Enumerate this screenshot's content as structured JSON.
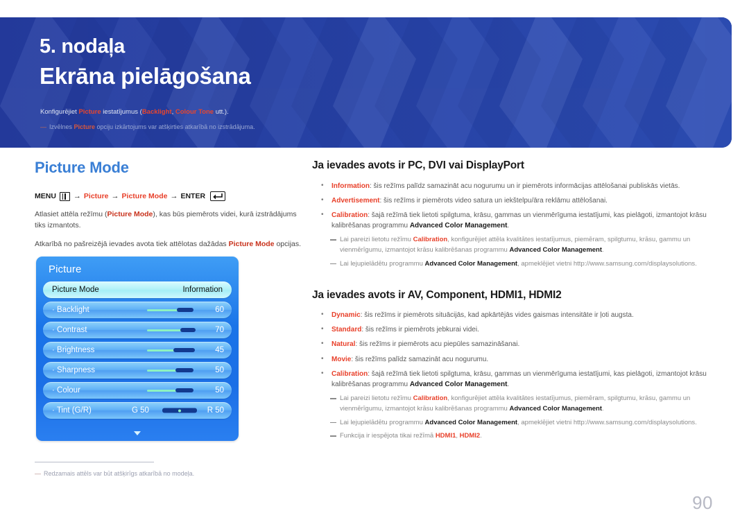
{
  "banner": {
    "chapter_no": "5. nodaļa",
    "chapter_title": "Ekrāna pielāgošana",
    "desc_prefix": "Konfigurējiet ",
    "desc_kw1": "Picture",
    "desc_mid": " iestatījumus (",
    "desc_kw2": "Backlight",
    "desc_sep": ", ",
    "desc_kw3": "Colour Tone",
    "desc_suffix": " utt.).",
    "note_prefix": "Izvēlnes ",
    "note_kw": "Picture",
    "note_suffix": " opciju izkārtojums var atšķirties atkarībā no izstrādājuma."
  },
  "left": {
    "section_title": "Picture Mode",
    "menu_path": {
      "menu": "MENU",
      "arrow": "→",
      "step1": "Picture",
      "step2": "Picture Mode",
      "enter": "ENTER"
    },
    "para1_a": "Atlasiet attēla režīmu (",
    "para1_kw": "Picture Mode",
    "para1_b": "), kas būs piemērots videi, kurā izstrādājums tiks izmantots.",
    "para2_a": "Atkarībā no pašreizējā ievades avota tiek attēlotas dažādas ",
    "para2_kw": "Picture Mode",
    "para2_b": " opcijas.",
    "footnote": "Redzamais attēls var būt atšķirīgs atkarībā no modeļa."
  },
  "osd": {
    "title": "Picture",
    "selected_row": {
      "label": "Picture Mode",
      "value": "Information"
    },
    "rows": [
      {
        "label": "· Backlight",
        "value": "60",
        "fill": 58,
        "thumb": 52
      },
      {
        "label": "· Contrast",
        "value": "70",
        "fill": 62,
        "thumb": 58
      },
      {
        "label": "· Brightness",
        "value": "45",
        "fill": 52,
        "thumb": 46
      },
      {
        "label": "· Sharpness",
        "value": "50",
        "fill": 56,
        "thumb": 50
      },
      {
        "label": "· Colour",
        "value": "50",
        "fill": 56,
        "thumb": 50
      }
    ],
    "tint": {
      "label": "· Tint (G/R)",
      "left_value": "G 50",
      "right_value": "R 50"
    }
  },
  "right": {
    "heading1": "Ja ievades avots ir PC, DVI vai DisplayPort",
    "bullets1": [
      {
        "kw": "Information",
        "text": ": šis režīms palīdz samazināt acu nogurumu un ir piemērots informācijas attēlošanai publiskās vietās."
      },
      {
        "kw": "Advertisement",
        "text": ": šis režīms ir piemērots video satura un iekštelpu/āra reklāmu attēlošanai."
      },
      {
        "kw": "Calibration",
        "text": ": šajā režīmā tiek lietoti spilgtuma, krāsu, gammas un vienmērīguma iestatījumi, kas pielāgoti, izmantojot krāsu kalibrēšanas programmu ",
        "bold_tail": "Advanced Color Management",
        "tail_end": "."
      }
    ],
    "notes1": [
      {
        "a": "Lai pareizi lietotu režīmu ",
        "kw": "Calibration",
        "b": ", konfigurējiet attēla kvalitātes iestatījumus, piemēram, spilgtumu, krāsu, gammu un vienmērīgumu, izmantojot krāsu kalibrēšanas programmu ",
        "bold": "Advanced Color Management",
        "c": "."
      },
      {
        "a": "Lai lejupielādētu programmu ",
        "bold": "Advanced Color Management",
        "b": ", apmeklējiet vietni http://www.samsung.com/displaysolutions."
      }
    ],
    "heading2": "Ja ievades avots ir AV, Component, HDMI1, HDMI2",
    "bullets2": [
      {
        "kw": "Dynamic",
        "text": ": šis režīms ir piemērots situācijās, kad apkārtējās vides gaismas intensitāte ir ļoti augsta."
      },
      {
        "kw": "Standard",
        "text": ": šis režīms ir piemērots jebkurai videi."
      },
      {
        "kw": "Natural",
        "text": ": šis režīms ir piemērots acu piepūles samazināšanai."
      },
      {
        "kw": "Movie",
        "text": ": šis režīms palīdz samazināt acu nogurumu."
      },
      {
        "kw": "Calibration",
        "text": ": šajā režīmā tiek lietoti spilgtuma, krāsu, gammas un vienmērīguma iestatījumi, kas pielāgoti, izmantojot krāsu kalibrēšanas programmu ",
        "bold_tail": "Advanced Color Management",
        "tail_end": "."
      }
    ],
    "notes2": [
      {
        "a": "Lai pareizi lietotu režīmu ",
        "kw": "Calibration",
        "b": ", konfigurējiet attēla kvalitātes iestatījumus, piemēram, spilgtumu, krāsu, gammu un vienmērīgumu, izmantojot krāsu kalibrēšanas programmu ",
        "bold": "Advanced Color Management",
        "c": "."
      },
      {
        "a": "Lai lejupielādētu programmu ",
        "bold": "Advanced Color Management",
        "b": ", apmeklējiet vietni http://www.samsung.com/displaysolutions."
      },
      {
        "a": "Funkcija ir iespējota tikai režīmā ",
        "kw2a": "HDMI1",
        "mid": ", ",
        "kw2b": "HDMI2",
        "c": "."
      }
    ]
  },
  "page_number": "90",
  "colors": {
    "banner_bg": "#25409a",
    "section_title": "#3a7fd5",
    "keyword_red": "#e8402a",
    "osd_blue": "#1a74e8",
    "osd_selected": "#b2f2f8",
    "slider_fill": "#8df2c0",
    "slider_thumb": "#123a8f",
    "page_number": "#b7b9c4"
  }
}
